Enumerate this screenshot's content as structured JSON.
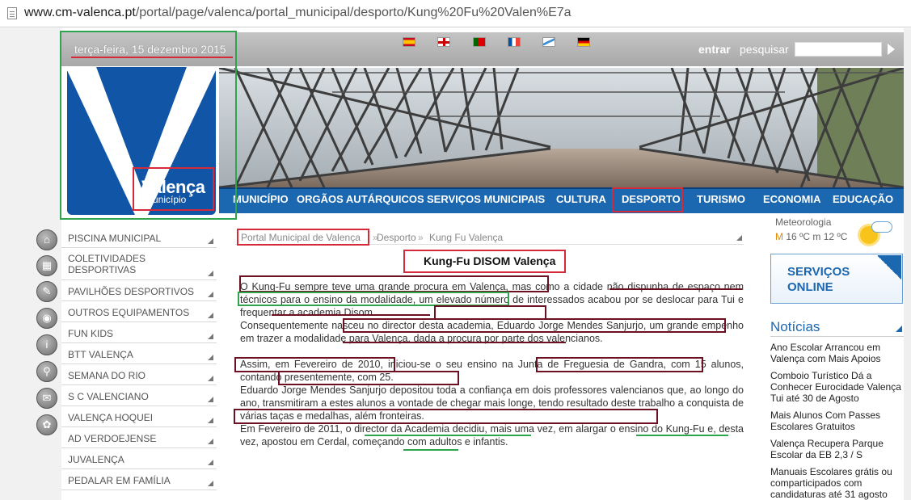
{
  "browser": {
    "url_prefix": "www.cm-valenca.pt",
    "url_path": "/portal/page/valenca/portal_municipal/desporto/Kung%20Fu%20Valen%E7a"
  },
  "header": {
    "date": "terça-feira, 15 dezembro 2015",
    "login_label": "entrar",
    "search_label": "pesquisar",
    "search_value": "",
    "flags": [
      "spanish-flag",
      "english-flag",
      "portuguese-flag",
      "french-flag",
      "galician-flag",
      "german-flag"
    ]
  },
  "logo": {
    "word": "Valença",
    "subtitle": "Município"
  },
  "nav": [
    "MUNICÍPIO",
    "ORGÃOS AUTÁRQUICOS",
    "SERVIÇOS MUNICIPAIS",
    "CULTURA",
    "DESPORTO",
    "TURISMO",
    "ECONOMIA",
    "EDUCAÇÃO"
  ],
  "sidebar": [
    {
      "label": "PISCINA MUNICIPAL",
      "icon": "house-icon"
    },
    {
      "label": "COLETIVIDADES DESPORTIVAS",
      "icon": "grid-icon"
    },
    {
      "label": "PAVILHÕES DESPORTIVOS",
      "icon": "pencil-icon"
    },
    {
      "label": "OUTROS EQUIPAMENTOS",
      "icon": "camera-icon"
    },
    {
      "label": "FUN KIDS",
      "icon": "info-icon"
    },
    {
      "label": "BTT VALENÇA",
      "icon": "map-pin-icon"
    },
    {
      "label": "SEMANA DO RIO",
      "icon": "envelope-icon"
    },
    {
      "label": "S C VALENCIANO",
      "icon": "flower-icon"
    },
    {
      "label": "VALENÇA HOQUEI",
      "icon": "none"
    },
    {
      "label": "AD VERDOEJENSE",
      "icon": "none"
    },
    {
      "label": "JUVALENÇA",
      "icon": "none"
    },
    {
      "label": "PEDALAR EM FAMÍLIA",
      "icon": "none"
    }
  ],
  "breadcrumb": {
    "home": "Portal Municipal de Valença",
    "sep": "»",
    "section": "Desporto",
    "current": "Kung Fu Valença"
  },
  "article": {
    "title": "Kung-Fu DISOM Valença",
    "p1": "O Kung-Fu sempre teve uma grande procura em Valença, mas como a cidade não dispunha de espaço nem técnicos para o ensino da modalidade, um elevado número de interessados acabou por se deslocar para Tui e frequentar a academia Disom.",
    "p2": "Consequentemente nasceu no director desta academia, Eduardo Jorge Mendes Sanjurjo, um grande empenho em trazer a modalidade para Valença, dada a procura por parte dos valencianos.",
    "p3": "Assim, em Fevereiro de 2010, iniciou-se o seu ensino na Junta de Freguesia de Gandra, com 15 alunos, contando presentemente, com 25.",
    "p4": "Eduardo Jorge Mendes Sanjurjo depositou toda a confiança em dois professores valencianos que, ao longo do ano, transmitiram a estes alunos a vontade de chegar mais longe, tendo resultado deste trabalho a conquista de várias taças e medalhas, além fronteiras.",
    "p5": "Em Fevereiro de 2011, o director da Academia decidiu, mais uma vez, em alargar o ensino do Kung-Fu e, desta vez, apostou em Cerdal, começando com adultos e infantis."
  },
  "weather": {
    "label": "Meteorologia",
    "max_prefix": "M",
    "temps": "16 ºC m 12 ºC",
    "icon": "sun-cloud-icon"
  },
  "services": {
    "line1": "SERVIÇOS",
    "line2": "ONLINE"
  },
  "news": {
    "title": "Notícias",
    "items": [
      "Ano Escolar Arrancou em Valença com Mais Apoios",
      "Comboio Turístico Dá a Conhecer Eurocidade Valença Tui até 30 de Agosto",
      "Mais Alunos Com Passes Escolares Gratuitos",
      "Valença Recupera Parque Escolar da EB 2,3 / S",
      "Manuais Escolares grátis ou comparticipados com candidaturas até 31 agosto"
    ]
  },
  "colors": {
    "nav_blue": "#1b67b0",
    "annotation_red": "#d42a3a",
    "annotation_dark": "#6d1122",
    "annotation_green": "#2ea44f"
  }
}
